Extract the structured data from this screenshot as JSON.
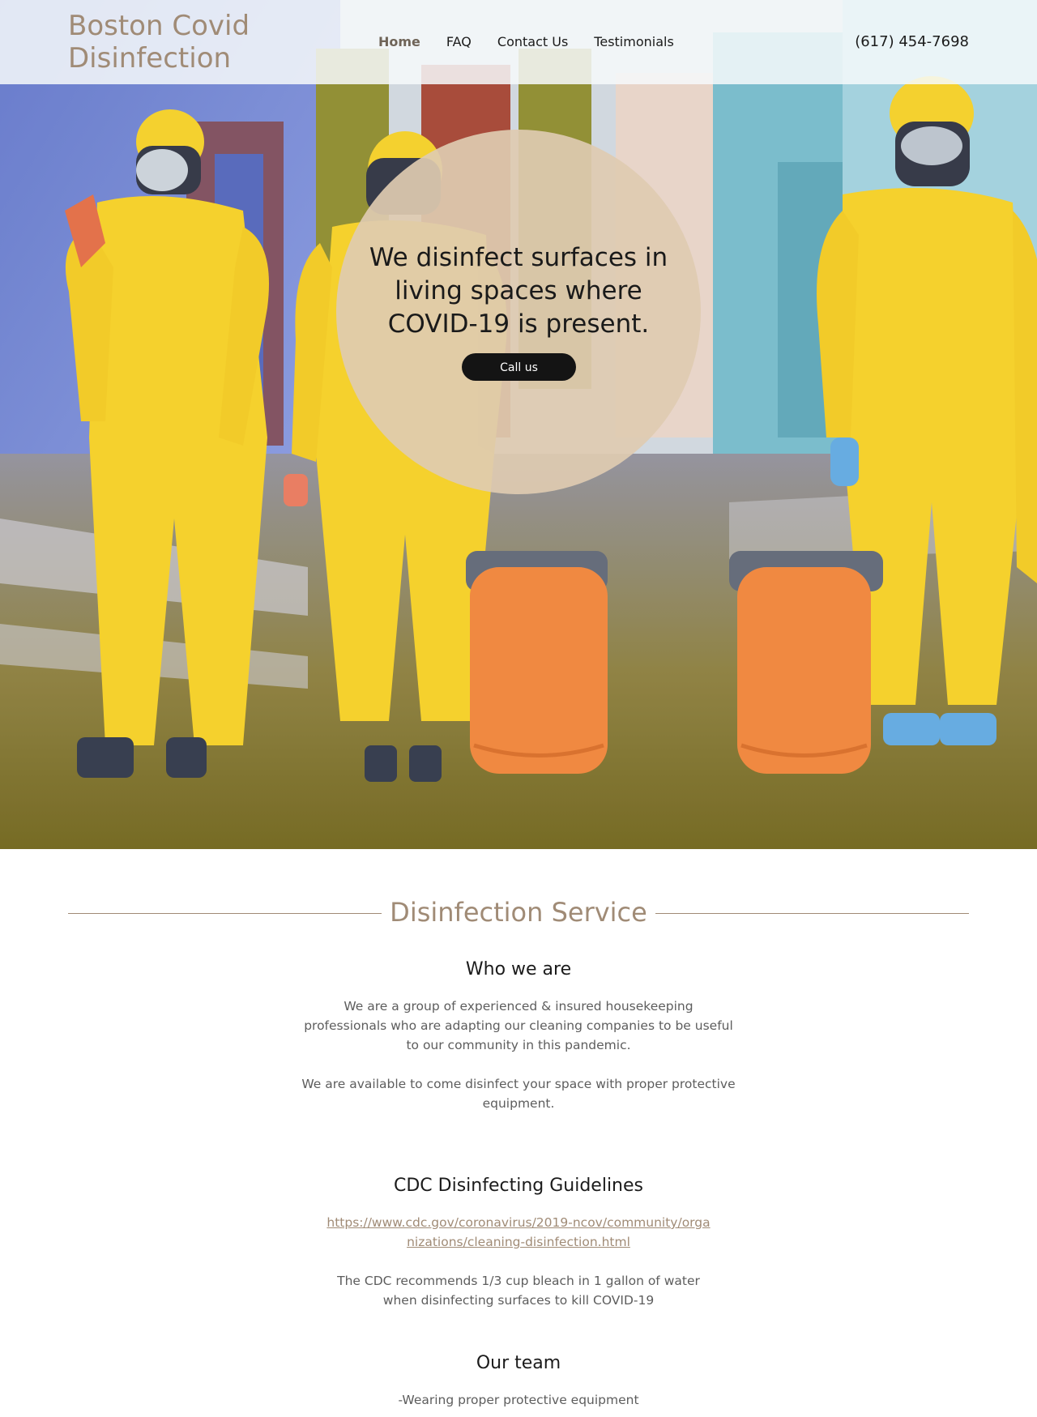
{
  "site": {
    "logo_line1": "Boston Covid",
    "logo_line2": "Disinfection",
    "phone": "(617) 454-7698"
  },
  "nav": {
    "items": [
      {
        "label": "Home",
        "active": true
      },
      {
        "label": "FAQ",
        "active": false
      },
      {
        "label": "Contact Us",
        "active": false
      },
      {
        "label": "Testimonials",
        "active": false
      }
    ]
  },
  "hero": {
    "title": "We disinfect surfaces in living spaces where COVID-19 is present.",
    "button_label": "Call us"
  },
  "colors": {
    "accent": "#a08b76",
    "button_bg": "#141414",
    "circle_bg": "#decbb1",
    "suit_yellow": "#f6d21e",
    "barrel_orange": "#f08236"
  },
  "section": {
    "title": "Disinfection Service",
    "who_heading": "Who we are",
    "who_p1": "We are a group of experienced & insured housekeeping professionals who are adapting our cleaning companies to be useful to our community in this pandemic.",
    "who_p2": "We are available to come disinfect your space with proper protective equipment.",
    "cdc_heading": "CDC Disinfecting Guidelines",
    "cdc_link": "https://www.cdc.gov/coronavirus/2019-ncov/community/organizations/cleaning-disinfection.html",
    "cdc_p": "The CDC recommends 1/3 cup bleach in 1 gallon of water when disinfecting surfaces to kill COVID-19",
    "team_heading": "Our team",
    "team_item1": "-Wearing proper protective equipment"
  }
}
